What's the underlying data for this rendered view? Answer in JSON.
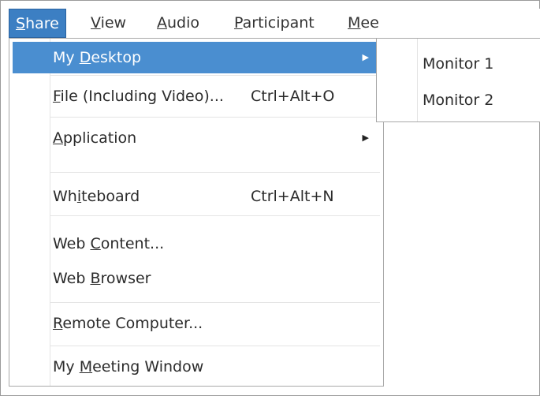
{
  "menubar": {
    "items": [
      {
        "pre": "",
        "ul": "S",
        "post": "hare"
      },
      {
        "pre": "",
        "ul": "V",
        "post": "iew"
      },
      {
        "pre": "",
        "ul": "A",
        "post": "udio"
      },
      {
        "pre": "",
        "ul": "P",
        "post": "articipant"
      },
      {
        "pre": "",
        "ul": "M",
        "post": "ee"
      }
    ]
  },
  "share_menu": {
    "items": [
      {
        "pre": "My ",
        "ul": "D",
        "post": "esktop",
        "shortcut": "",
        "submenu_arrow": "▶"
      },
      {
        "pre": "",
        "ul": "F",
        "post": "ile (Including Video)...",
        "shortcut": "Ctrl+Alt+O",
        "submenu_arrow": ""
      },
      {
        "pre": "",
        "ul": "A",
        "post": "pplication",
        "shortcut": "",
        "submenu_arrow": "▶"
      },
      {
        "pre": "Wh",
        "ul": "i",
        "post": "teboard",
        "shortcut": "Ctrl+Alt+N",
        "submenu_arrow": ""
      },
      {
        "pre": "Web ",
        "ul": "C",
        "post": "ontent...",
        "shortcut": "",
        "submenu_arrow": ""
      },
      {
        "pre": "Web ",
        "ul": "B",
        "post": "rowser",
        "shortcut": "",
        "submenu_arrow": ""
      },
      {
        "pre": "",
        "ul": "R",
        "post": "emote Computer...",
        "shortcut": "",
        "submenu_arrow": ""
      },
      {
        "pre": "My ",
        "ul": "M",
        "post": "eeting Window",
        "shortcut": "",
        "submenu_arrow": ""
      }
    ]
  },
  "desktop_submenu": {
    "items": [
      {
        "label": "Monitor 1"
      },
      {
        "label": "Monitor 2"
      }
    ]
  },
  "colors": {
    "highlight": "#4a8ed0",
    "menubar_active": "#3c7fc3"
  }
}
